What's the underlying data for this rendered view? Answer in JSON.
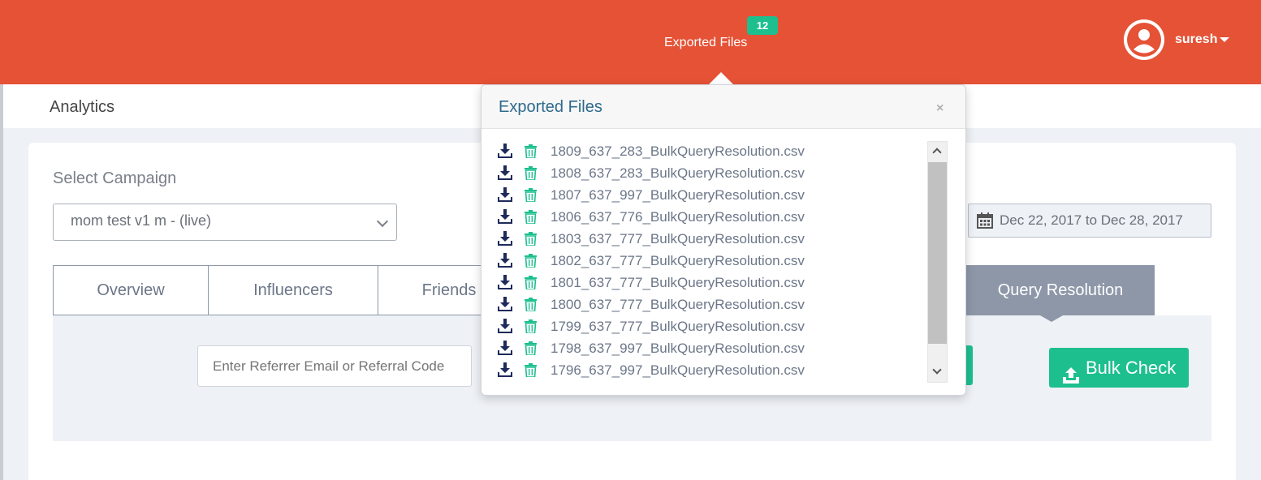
{
  "header": {
    "exported_label": "Exported Files",
    "exported_count": "12",
    "username": "suresh",
    "brand_color": "#e55236",
    "icons": {
      "avatar": "user-avatar-icon",
      "caret": "caret-down-icon"
    }
  },
  "subheader": {
    "title": "Analytics"
  },
  "main": {
    "select_label": "Select Campaign",
    "campaign_value": "mom test v1 m - (live)",
    "date_range": "Dec 22, 2017 to Dec 28, 2017",
    "tabs": [
      {
        "label": "Overview",
        "active": false
      },
      {
        "label": "Influencers",
        "active": false
      },
      {
        "label": "Friends",
        "active": false
      },
      {
        "label": "Query Resolution",
        "active": true
      }
    ],
    "search_placeholder": "Enter Referrer Email or Referral Code",
    "bulk_check_label": "Bulk Check",
    "accent_color": "#1dbf8f",
    "tab_active_color": "#8d97a8"
  },
  "popover": {
    "title": "Exported Files",
    "close_symbol": "×",
    "files": [
      "1809_637_283_BulkQueryResolution.csv",
      "1808_637_283_BulkQueryResolution.csv",
      "1807_637_997_BulkQueryResolution.csv",
      "1806_637_776_BulkQueryResolution.csv",
      "1803_637_777_BulkQueryResolution.csv",
      "1802_637_777_BulkQueryResolution.csv",
      "1801_637_777_BulkQueryResolution.csv",
      "1800_637_777_BulkQueryResolution.csv",
      "1799_637_777_BulkQueryResolution.csv",
      "1798_637_997_BulkQueryResolution.csv",
      "1796_637_997_BulkQueryResolution.csv"
    ]
  }
}
